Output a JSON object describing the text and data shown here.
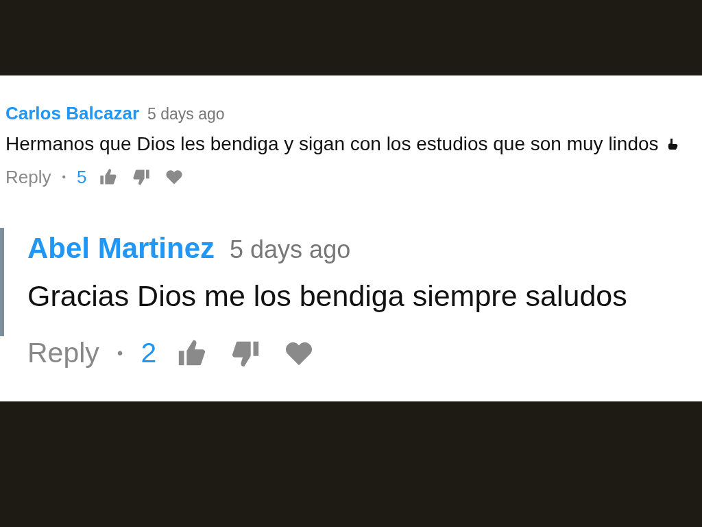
{
  "comments": [
    {
      "kind": "comment",
      "author": "Carlos Balcazar",
      "time": "5 days ago",
      "text": "Hermanos que Dios les bendiga y sigan con los estudios que son muy lindos",
      "emoji": true,
      "reply": "Reply",
      "separator": "•",
      "likes": "5"
    },
    {
      "kind": "reply",
      "author": "Abel Martinez",
      "time": "5 days ago",
      "text": "Gracias Dios me los bendiga siempre saludos",
      "emoji": false,
      "reply": "Reply",
      "separator": "•",
      "likes": "2"
    }
  ]
}
